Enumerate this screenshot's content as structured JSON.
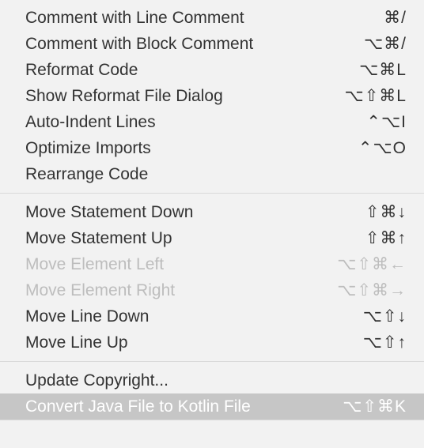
{
  "menu": {
    "groups": [
      [
        {
          "id": "comment-line",
          "label": "Comment with Line Comment",
          "shortcut": "⌘/",
          "disabled": false
        },
        {
          "id": "comment-block",
          "label": "Comment with Block Comment",
          "shortcut": "⌥⌘/",
          "disabled": false
        },
        {
          "id": "reformat-code",
          "label": "Reformat Code",
          "shortcut": "⌥⌘L",
          "disabled": false
        },
        {
          "id": "reformat-dialog",
          "label": "Show Reformat File Dialog",
          "shortcut": "⌥⇧⌘L",
          "disabled": false
        },
        {
          "id": "auto-indent",
          "label": "Auto-Indent Lines",
          "shortcut": "⌃⌥I",
          "disabled": false
        },
        {
          "id": "optimize-imports",
          "label": "Optimize Imports",
          "shortcut": "⌃⌥O",
          "disabled": false
        },
        {
          "id": "rearrange-code",
          "label": "Rearrange Code",
          "shortcut": "",
          "disabled": false
        }
      ],
      [
        {
          "id": "move-stmt-down",
          "label": "Move Statement Down",
          "shortcut": "⇧⌘↓",
          "disabled": false
        },
        {
          "id": "move-stmt-up",
          "label": "Move Statement Up",
          "shortcut": "⇧⌘↑",
          "disabled": false
        },
        {
          "id": "move-elem-left",
          "label": "Move Element Left",
          "shortcut": "⌥⇧⌘←",
          "disabled": true
        },
        {
          "id": "move-elem-right",
          "label": "Move Element Right",
          "shortcut": "⌥⇧⌘→",
          "disabled": true
        },
        {
          "id": "move-line-down",
          "label": "Move Line Down",
          "shortcut": "⌥⇧↓",
          "disabled": false
        },
        {
          "id": "move-line-up",
          "label": "Move Line Up",
          "shortcut": "⌥⇧↑",
          "disabled": false
        }
      ],
      [
        {
          "id": "update-copyright",
          "label": "Update Copyright...",
          "shortcut": "",
          "disabled": false
        },
        {
          "id": "convert-kotlin",
          "label": "Convert Java File to Kotlin File",
          "shortcut": "⌥⇧⌘K",
          "disabled": false,
          "highlight": true
        }
      ]
    ]
  }
}
